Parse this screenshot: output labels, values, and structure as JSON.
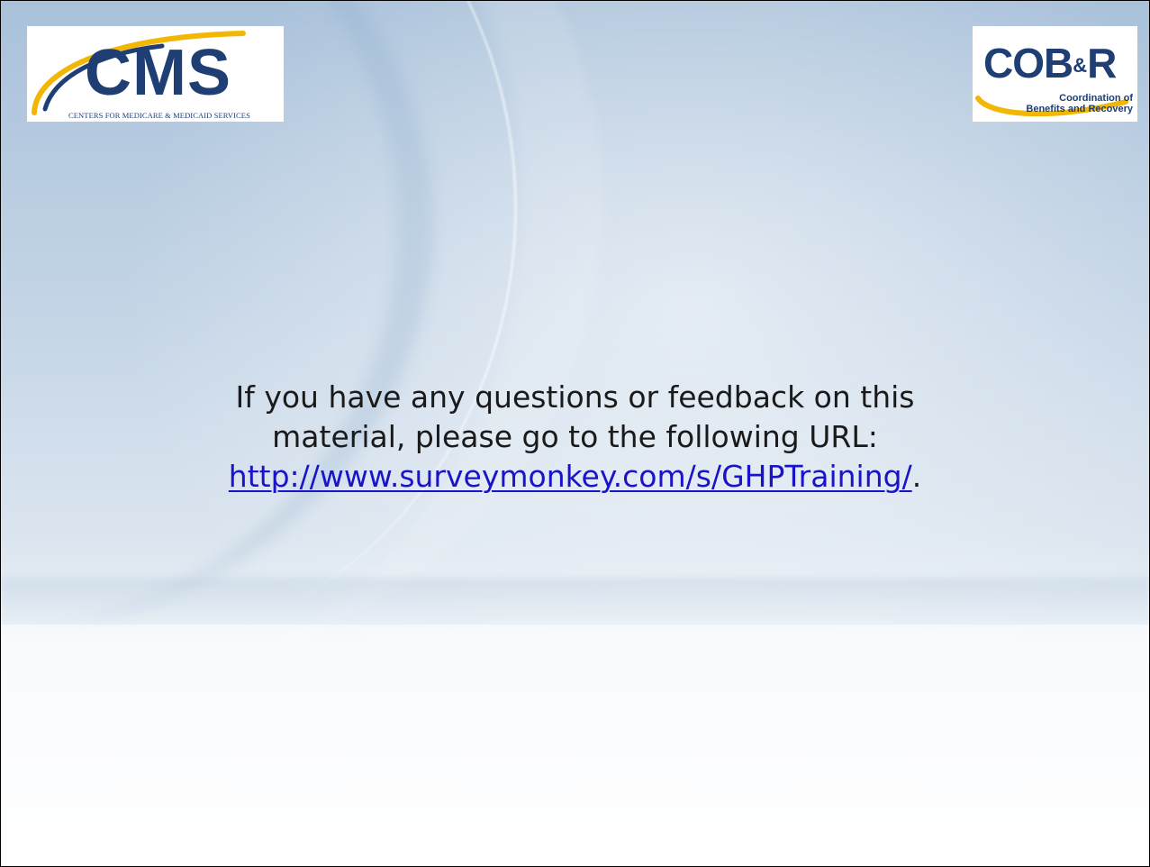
{
  "logos": {
    "cms": {
      "wordmark": "CMS",
      "subtitle": "CENTERS FOR MEDICARE & MEDICAID SERVICES"
    },
    "cobr": {
      "wordmark": "COB",
      "ampersand": "&",
      "letter": "R",
      "tagline_line1": "Coordination of",
      "tagline_line2": "Benefits and Recovery"
    }
  },
  "message": {
    "line1": "If you have any questions or feedback on this",
    "line2": "material, please go to the following URL:",
    "link_text": "http://www.surveymonkey.com/s/GHPTraining/",
    "trailing": "."
  },
  "colors": {
    "brand_navy": "#1f3e74",
    "brand_gold": "#f2b705",
    "link_blue": "#1a14c8"
  }
}
